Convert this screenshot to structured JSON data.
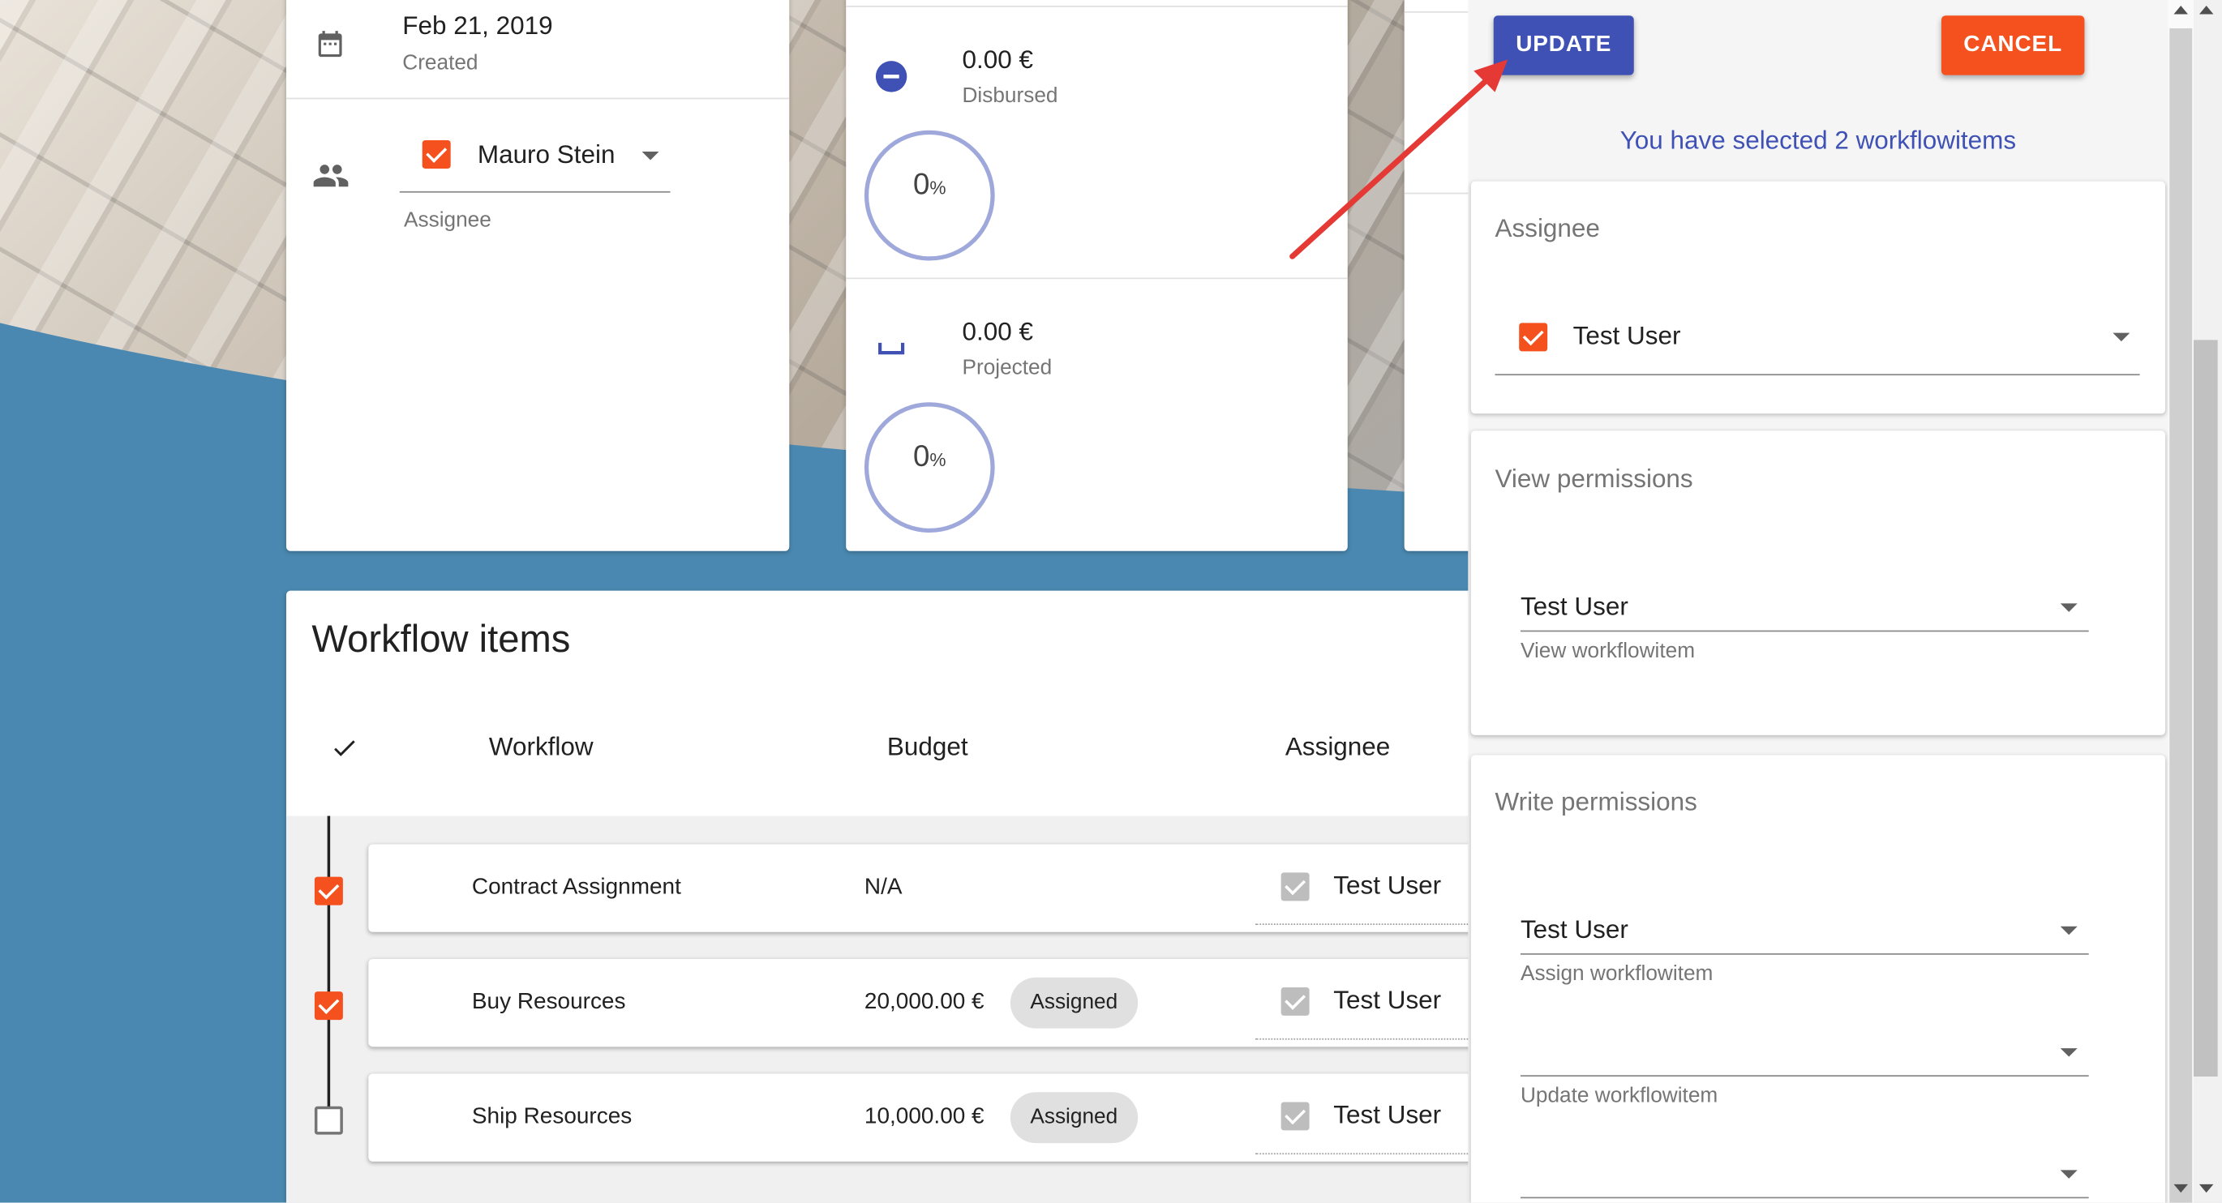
{
  "project_info": {
    "created_date": "Feb 21, 2019",
    "created_label": "Created",
    "assignee_name": "Mauro Stein",
    "assignee_label": "Assignee"
  },
  "budget_card": {
    "disbursed_amount": "0.00 €",
    "disbursed_label": "Disbursed",
    "disbursed_percent": "0",
    "projected_amount": "0.00 €",
    "projected_label": "Projected",
    "projected_percent": "0",
    "percent_sign": "%"
  },
  "workflow": {
    "title": "Workflow items",
    "columns": {
      "workflow": "Workflow",
      "budget": "Budget",
      "assignee": "Assignee"
    },
    "rows": [
      {
        "name": "Contract Assignment",
        "budget": "N/A",
        "status": "",
        "assignee": "Test User",
        "selected": true
      },
      {
        "name": "Buy Resources",
        "budget": "20,000.00 €",
        "status": "Assigned",
        "assignee": "Test User",
        "selected": true
      },
      {
        "name": "Ship Resources",
        "budget": "10,000.00 €",
        "status": "Assigned",
        "assignee": "Test User",
        "selected": false
      }
    ]
  },
  "side_panel": {
    "update_label": "UPDATE",
    "cancel_label": "CANCEL",
    "selection_text": "You have selected 2 workflowitems",
    "assignee_section": {
      "title": "Assignee",
      "value": "Test User"
    },
    "view_section": {
      "title": "View permissions",
      "value": "Test User",
      "hint": "View workflowitem"
    },
    "write_section": {
      "title": "Write permissions",
      "assign_value": "Test User",
      "assign_hint": "Assign workflowitem",
      "update_value": "",
      "update_hint": "Update workflowitem",
      "extra_value": ""
    }
  },
  "colors": {
    "primary": "#3f51b5",
    "accent": "#f4511e",
    "annotation_arrow": "#e53935"
  }
}
